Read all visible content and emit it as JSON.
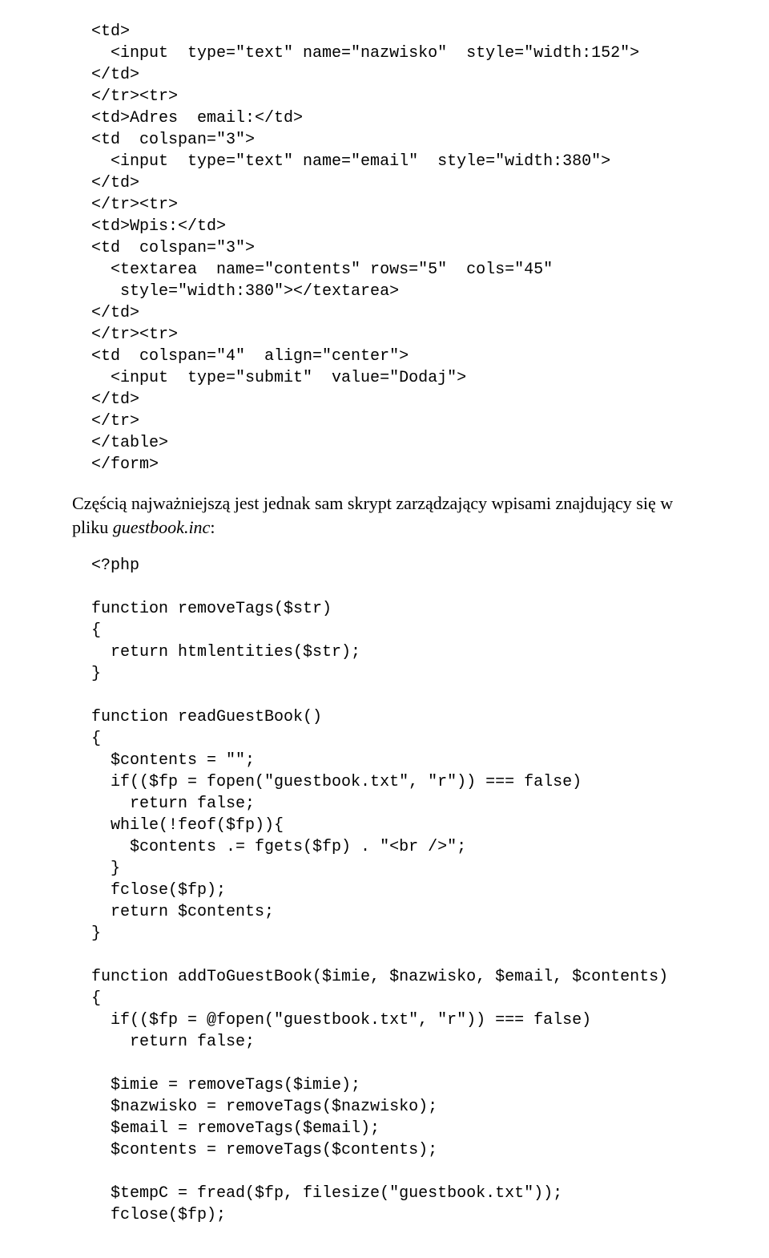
{
  "code1": "  <td>\n    <input  type=\"text\" name=\"nazwisko\"  style=\"width:152\">\n  </td>\n  </tr><tr>\n  <td>Adres  email:</td>\n  <td  colspan=\"3\">\n    <input  type=\"text\" name=\"email\"  style=\"width:380\">\n  </td>\n  </tr><tr>\n  <td>Wpis:</td>\n  <td  colspan=\"3\">\n    <textarea  name=\"contents\" rows=\"5\"  cols=\"45\"\n     style=\"width:380\"></textarea>\n  </td>\n  </tr><tr>\n  <td  colspan=\"4\"  align=\"center\">\n    <input  type=\"submit\"  value=\"Dodaj\">\n  </td>\n  </tr>\n  </table>\n  </form>",
  "para_before": "Częścią najważniejszą jest jednak sam skrypt zarządzający wpisami znajdujący się w pliku ",
  "filename": "guestbook.inc",
  "para_after": ":",
  "code2": "  <?php\n\n  function removeTags($str)\n  {\n    return htmlentities($str);\n  }\n\n  function readGuestBook()\n  {\n    $contents = \"\";\n    if(($fp = fopen(\"guestbook.txt\", \"r\")) === false)\n      return false;\n    while(!feof($fp)){\n      $contents .= fgets($fp) . \"<br />\";\n    }\n    fclose($fp);\n    return $contents;\n  }\n\n  function addToGuestBook($imie, $nazwisko, $email, $contents)\n  {\n    if(($fp = @fopen(\"guestbook.txt\", \"r\")) === false)\n      return false;\n\n    $imie = removeTags($imie);\n    $nazwisko = removeTags($nazwisko);\n    $email = removeTags($email);\n    $contents = removeTags($contents);\n\n    $tempC = fread($fp, filesize(\"guestbook.txt\"));\n    fclose($fp);"
}
